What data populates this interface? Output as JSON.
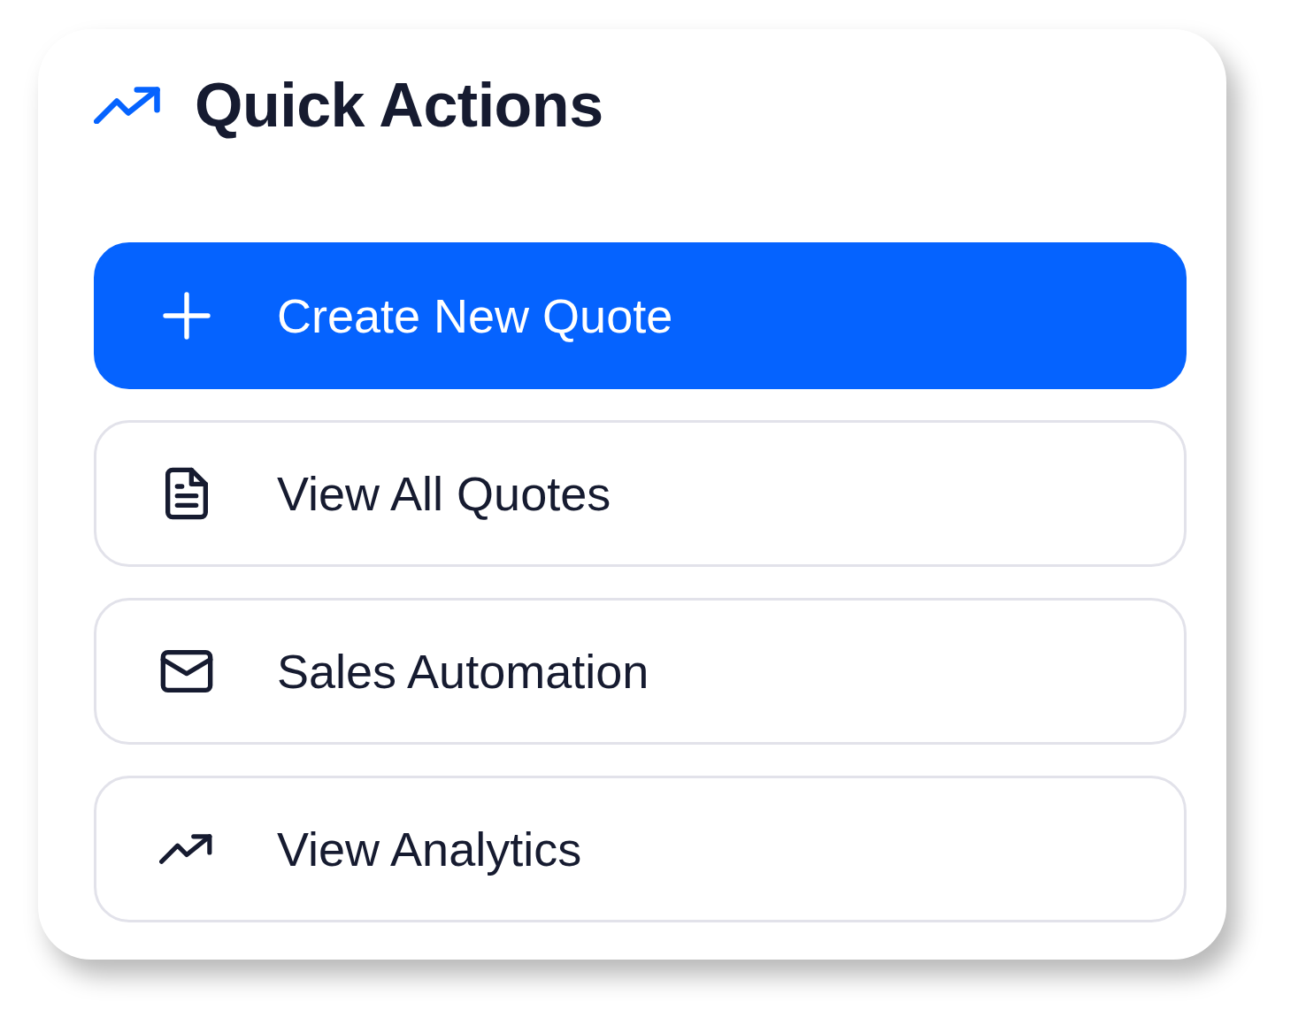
{
  "title": "Quick Actions",
  "actions": [
    {
      "label": "Create New Quote",
      "kind": "primary"
    },
    {
      "label": "View All Quotes",
      "kind": "outline"
    },
    {
      "label": "Sales Automation",
      "kind": "outline"
    },
    {
      "label": "View Analytics",
      "kind": "outline"
    }
  ]
}
